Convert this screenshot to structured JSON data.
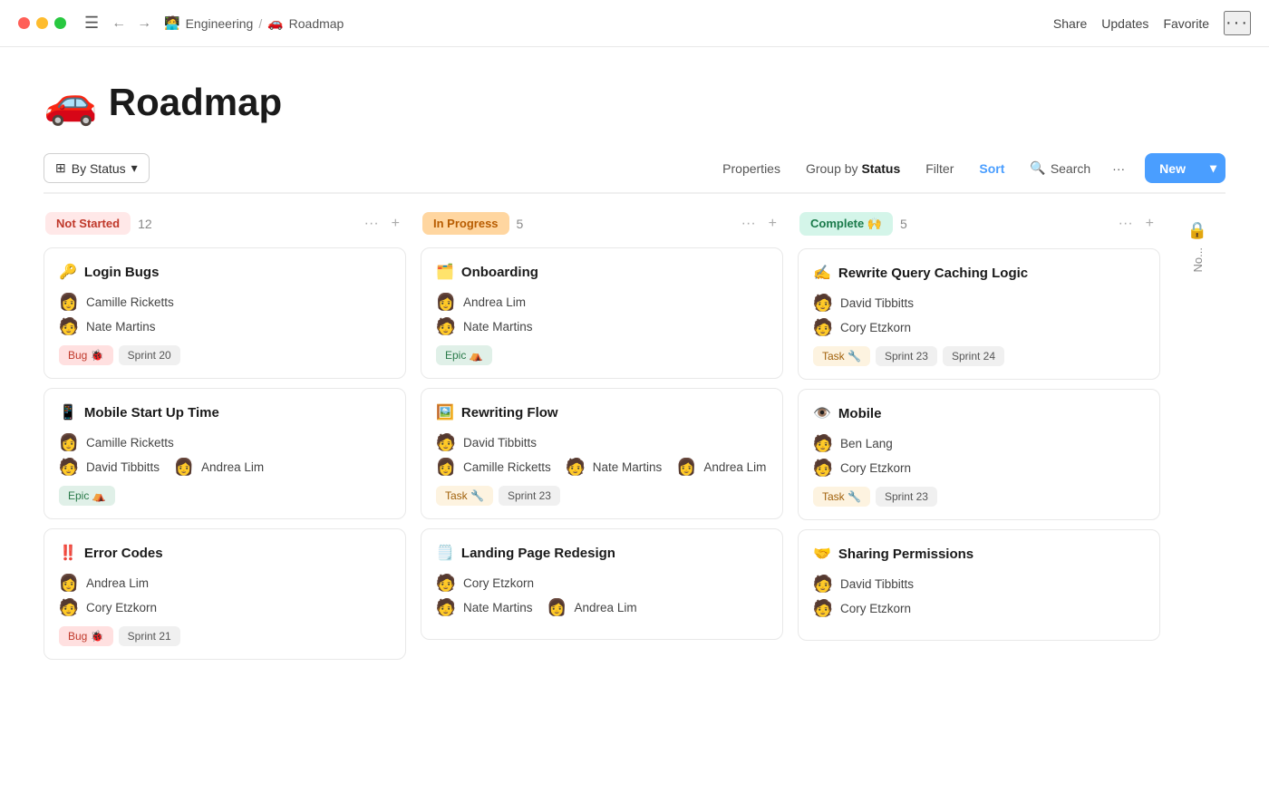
{
  "titlebar": {
    "breadcrumb_workspace": "Engineering",
    "breadcrumb_sep": "/",
    "breadcrumb_page": "Roadmap",
    "workspace_emoji": "🧑‍💻",
    "page_emoji": "🚗",
    "share": "Share",
    "updates": "Updates",
    "favorite": "Favorite",
    "more": "···"
  },
  "page": {
    "emoji": "🚗",
    "title": "Roadmap"
  },
  "toolbar": {
    "by_status": "By Status",
    "properties": "Properties",
    "group_by_label": "Group by",
    "group_by_value": "Status",
    "filter": "Filter",
    "sort": "Sort",
    "search": "Search",
    "more": "···",
    "new": "New"
  },
  "columns": [
    {
      "id": "not-started",
      "status": "Not Started",
      "status_class": "not-started",
      "count": 12,
      "cards": [
        {
          "emoji": "🔑",
          "title": "Login Bugs",
          "people": [
            {
              "name": "Camille Ricketts",
              "avatar": "👩"
            },
            {
              "name": "Nate Martins",
              "avatar": "🧑"
            }
          ],
          "tags": [
            {
              "label": "Bug 🐞",
              "class": "bug"
            },
            {
              "label": "Sprint 20",
              "class": "sprint"
            }
          ]
        },
        {
          "emoji": "📱",
          "title": "Mobile Start Up Time",
          "people": [
            {
              "name": "Camille Ricketts",
              "avatar": "👩"
            },
            {
              "name": "David Tibbitts",
              "avatar": "🧑"
            },
            {
              "name": "Andrea Lim",
              "avatar": "👩"
            }
          ],
          "tags": [
            {
              "label": "Epic ⛺",
              "class": "epic"
            }
          ]
        },
        {
          "emoji": "‼️",
          "title": "Error Codes",
          "people": [
            {
              "name": "Andrea Lim",
              "avatar": "👩"
            },
            {
              "name": "Cory Etzkorn",
              "avatar": "🧑"
            }
          ],
          "tags": [
            {
              "label": "Bug 🐞",
              "class": "bug"
            },
            {
              "label": "Sprint 21",
              "class": "sprint"
            }
          ]
        }
      ]
    },
    {
      "id": "in-progress",
      "status": "In Progress",
      "status_class": "in-progress",
      "count": 5,
      "cards": [
        {
          "emoji": "🗂️",
          "title": "Onboarding",
          "people": [
            {
              "name": "Andrea Lim",
              "avatar": "👩"
            },
            {
              "name": "Nate Martins",
              "avatar": "🧑"
            }
          ],
          "tags": [
            {
              "label": "Epic ⛺",
              "class": "epic"
            }
          ]
        },
        {
          "emoji": "🖼️",
          "title": "Rewriting Flow",
          "people": [
            {
              "name": "David Tibbitts",
              "avatar": "🧑"
            },
            {
              "name": "Camille Ricketts",
              "avatar": "👩"
            },
            {
              "name": "Nate Martins",
              "avatar": "🧑"
            },
            {
              "name": "Andrea Lim",
              "avatar": "👩"
            }
          ],
          "tags": [
            {
              "label": "Task 🔧",
              "class": "task"
            },
            {
              "label": "Sprint 23",
              "class": "sprint"
            }
          ]
        },
        {
          "emoji": "🗒️",
          "title": "Landing Page Redesign",
          "people": [
            {
              "name": "Cory Etzkorn",
              "avatar": "🧑"
            },
            {
              "name": "Nate Martins",
              "avatar": "🧑"
            },
            {
              "name": "Andrea Lim",
              "avatar": "👩"
            }
          ],
          "tags": []
        }
      ]
    },
    {
      "id": "complete",
      "status": "Complete 🙌",
      "status_class": "complete",
      "count": 5,
      "cards": [
        {
          "emoji": "✍️",
          "title": "Rewrite Query Caching Logic",
          "people": [
            {
              "name": "David Tibbitts",
              "avatar": "🧑"
            },
            {
              "name": "Cory Etzkorn",
              "avatar": "🧑"
            }
          ],
          "tags": [
            {
              "label": "Task 🔧",
              "class": "task"
            },
            {
              "label": "Sprint 23",
              "class": "sprint"
            },
            {
              "label": "Sprint 24",
              "class": "sprint"
            }
          ]
        },
        {
          "emoji": "👁️",
          "title": "Mobile",
          "people": [
            {
              "name": "Ben Lang",
              "avatar": "🧑"
            },
            {
              "name": "Cory Etzkorn",
              "avatar": "🧑"
            }
          ],
          "tags": [
            {
              "label": "Task 🔧",
              "class": "task"
            },
            {
              "label": "Sprint 23",
              "class": "sprint"
            }
          ]
        },
        {
          "emoji": "🤝",
          "title": "Sharing Permissions",
          "people": [
            {
              "name": "David Tibbitts",
              "avatar": "🧑"
            },
            {
              "name": "Cory Etzkorn",
              "avatar": "🧑"
            }
          ],
          "tags": []
        }
      ]
    }
  ],
  "hidden_col": {
    "icon": "🔒",
    "label": "No..."
  }
}
